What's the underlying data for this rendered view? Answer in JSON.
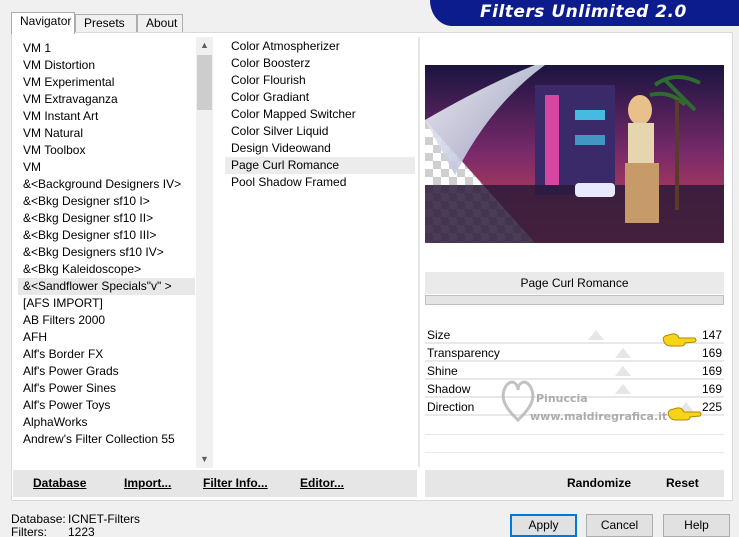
{
  "app": {
    "title": "Filters Unlimited 2.0"
  },
  "tabs": [
    {
      "label": "Navigator"
    },
    {
      "label": "Presets"
    },
    {
      "label": "About"
    }
  ],
  "categories": [
    "VM 1",
    "VM Distortion",
    "VM Experimental",
    "VM Extravaganza",
    "VM Instant Art",
    "VM Natural",
    "VM Toolbox",
    "VM",
    "&<Background Designers IV>",
    "&<Bkg Designer sf10 I>",
    "&<Bkg Designer sf10 II>",
    "&<Bkg Designer sf10 III>",
    "&<Bkg Designers sf10 IV>",
    "&<Bkg Kaleidoscope>",
    "&<Sandflower Specials\"v\" >",
    "[AFS IMPORT]",
    "AB Filters 2000",
    "AFH",
    "Alf's Border FX",
    "Alf's Power Grads",
    "Alf's Power Sines",
    "Alf's Power Toys",
    "AlphaWorks",
    "Andrew's Filter Collection 55"
  ],
  "filters": [
    "Color Atmospherizer",
    "Color Boosterz",
    "Color Flourish",
    "Color Gradiant",
    "Color Mapped Switcher",
    "Color Silver Liquid",
    "Design Videowand",
    "Page Curl Romance",
    "Pool Shadow Framed"
  ],
  "selected_filter": "Page Curl Romance",
  "params": [
    {
      "label": "Size",
      "value": "147"
    },
    {
      "label": "Transparency",
      "value": "169"
    },
    {
      "label": "Shine",
      "value": "169"
    },
    {
      "label": "Shadow",
      "value": "169"
    },
    {
      "label": "Direction",
      "value": "225"
    }
  ],
  "watermark": {
    "line1": "Pinuccia",
    "line2": "www.maldiregrafica.it"
  },
  "left_buttons": {
    "database": "Database",
    "import": "Import...",
    "filter_info": "Filter Info...",
    "editor": "Editor..."
  },
  "right_buttons": {
    "randomize": "Randomize",
    "reset": "Reset"
  },
  "footer": {
    "database_label": "Database:",
    "database_value": "ICNET-Filters",
    "filters_label": "Filters:",
    "filters_value": "1223"
  },
  "dialog_buttons": {
    "apply": "Apply",
    "cancel": "Cancel",
    "help": "Help"
  },
  "colors": {
    "banner": "#0c1c8c",
    "selection": "#e8e8e8",
    "default_button_border": "#0078d7"
  }
}
